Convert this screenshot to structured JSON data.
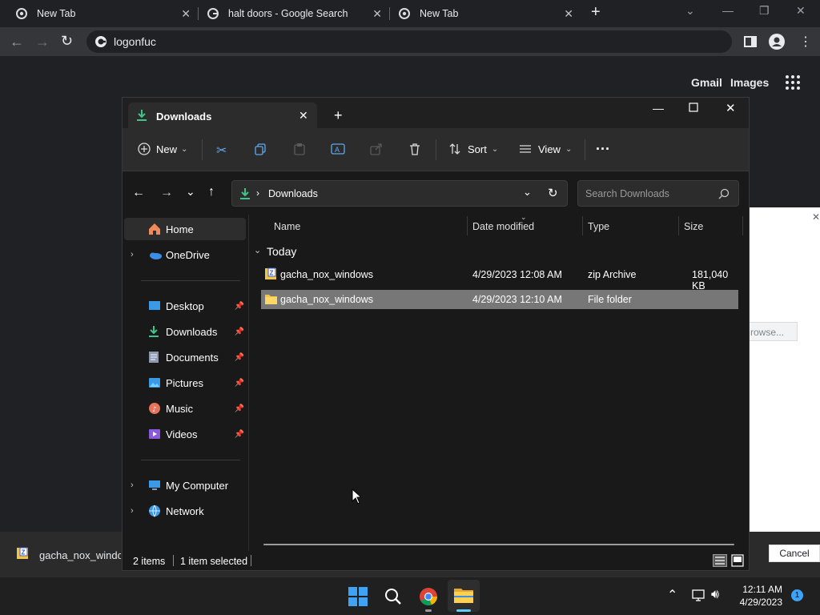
{
  "browser": {
    "tabs": [
      {
        "title": "New Tab"
      },
      {
        "title": "halt doors - Google Search"
      },
      {
        "title": "New Tab"
      }
    ],
    "address": "logonfuc",
    "page_links": {
      "gmail": "Gmail",
      "images": "Images"
    },
    "dialog": {
      "browse_label": "rowse...",
      "cancel_label": "Cancel"
    },
    "download_bar_item": "gacha_nox_windo"
  },
  "explorer": {
    "tab_title": "Downloads",
    "commands": {
      "new": "New",
      "sort": "Sort",
      "view": "View",
      "more": "···"
    },
    "address": {
      "path": "Downloads"
    },
    "search_placeholder": "Search Downloads",
    "nav": {
      "home": "Home",
      "onedrive": "OneDrive",
      "desktop": "Desktop",
      "downloads": "Downloads",
      "documents": "Documents",
      "pictures": "Pictures",
      "music": "Music",
      "videos": "Videos",
      "my_computer": "My Computer",
      "network": "Network"
    },
    "columns": {
      "name": "Name",
      "date": "Date modified",
      "type": "Type",
      "size": "Size"
    },
    "group": "Today",
    "files": [
      {
        "name": "gacha_nox_windows",
        "date": "4/29/2023 12:08 AM",
        "type": "zip Archive",
        "size": "181,040 KB"
      },
      {
        "name": "gacha_nox_windows",
        "date": "4/29/2023 12:10 AM",
        "type": "File folder",
        "size": ""
      }
    ],
    "status": {
      "items": "2 items",
      "selected": "1 item selected"
    }
  },
  "taskbar": {
    "time": "12:11 AM",
    "date": "4/29/2023",
    "notification_count": "1"
  },
  "colors": {
    "accent": "#0078d4",
    "selection": "#777777",
    "folder": "#f4c542"
  }
}
